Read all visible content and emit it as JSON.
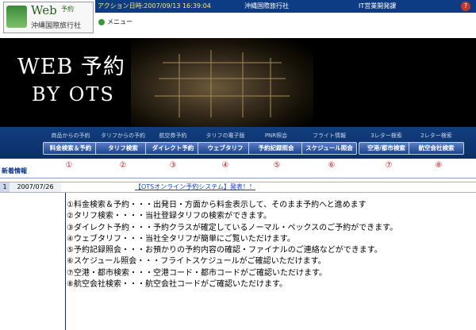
{
  "header": {
    "logo_main": "Web",
    "logo_sub_a": "予約",
    "logo_sub_b": "沖縄国際旅行社",
    "action_datetime": "アクション日時:2007/09/13 16:39:04",
    "agency": "沖縄国際旅行社",
    "developer": "IT営業開発課",
    "help_icon": "?",
    "menu_label": "メニュー"
  },
  "banner": {
    "title": "WEB 予約",
    "subtitle": "BY OTS"
  },
  "nav": {
    "items": [
      {
        "caption": "商品からの予約",
        "label": "料金検索＆予約"
      },
      {
        "caption": "タリフからの予約",
        "label": "タリフ検索"
      },
      {
        "caption": "航空券予約",
        "label": "ダイレクト予約"
      },
      {
        "caption": "タリフの電子版",
        "label": "ウェブタリフ"
      },
      {
        "caption": "PNR照会",
        "label": "予約記録照会"
      },
      {
        "caption": "フライト情報",
        "label": "スケジュール照会"
      },
      {
        "caption": "3レター検索",
        "label": "空港/都市検索"
      },
      {
        "caption": "2レター検索",
        "label": "航空会社検索"
      }
    ],
    "circled_numbers": [
      "①",
      "②",
      "③",
      "④",
      "⑤",
      "⑥",
      "⑦",
      "⑧"
    ]
  },
  "news": {
    "label": "新着情報",
    "rows": [
      {
        "num": "1",
        "date": "2007/07/26",
        "title": "【OTSオンライン予約システム】発表！！"
      }
    ]
  },
  "descriptions": [
    "①料金検索＆予約・・・出発日・方面から料金表示して、そのまま予約へと進めます",
    "②タリフ検索・・・・当社登録タリフの検索ができます。",
    "③ダイレクト予約・・・予約クラスが確定しているノーマル・ペックスのご予約ができます。",
    "④ウェブタリフ・・・当社全タリフが簡単にご覧いただけます。",
    "⑤予約記録照会・・・お預かりの予約内容の確認・ファイナルのご連絡などができます。",
    "⑥スケジュール照会・・・フライトスケジュールがご確認いただけます。",
    "⑦空港・都市検索・・・空港コード・都市コードがご確認いただけます。",
    "⑧航空会社検索・・・航空会社コードがご確認いただけます。"
  ],
  "colors": {
    "topbar": "#0d3c85",
    "nav": "#0a2f66",
    "circled": "#c02020",
    "link": "#1a3fc0"
  }
}
